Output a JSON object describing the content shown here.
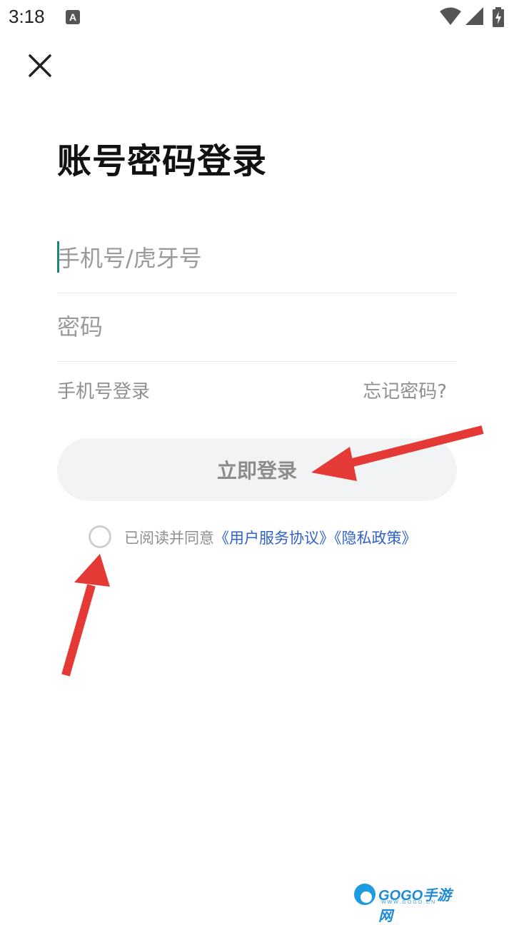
{
  "status_bar": {
    "time": "3:18",
    "notification_icon": "A"
  },
  "page": {
    "title": "账号密码登录",
    "phone_placeholder": "手机号/虎牙号",
    "password_placeholder": "密码",
    "phone_login_label": "手机号登录",
    "forgot_password_label": "忘记密码?",
    "login_button_label": "立即登录",
    "agreement_prefix": "已阅读并同意",
    "user_agreement_link": "《用户服务协议》",
    "privacy_policy_link": "《隐私政策》"
  },
  "watermark": {
    "brand": "GOGO手游网",
    "url": "WWW.GOGO.CN"
  },
  "colors": {
    "accent_cursor": "#1a8a78",
    "link_blue": "#2f63c6",
    "annotation_arrow": "#e53935"
  }
}
